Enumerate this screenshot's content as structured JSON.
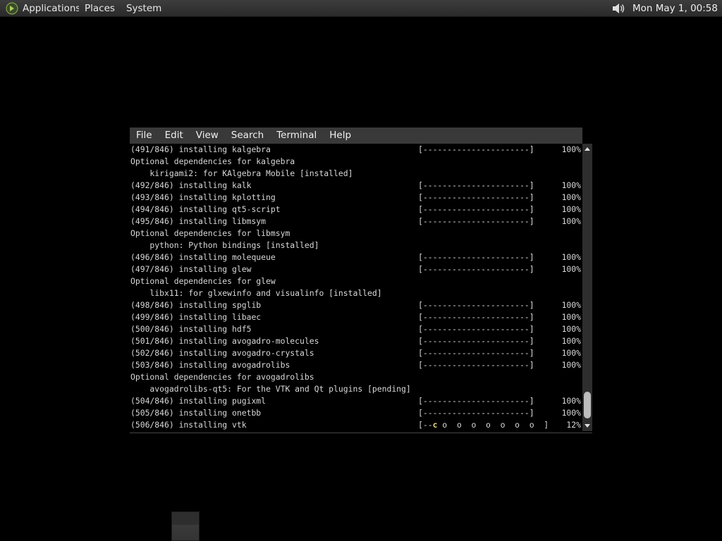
{
  "panel": {
    "menus": [
      "Applications",
      "Places",
      "System"
    ],
    "clock": "Mon May  1, 00:58",
    "logo_icon": "distro-logo-icon",
    "volume_icon": "speaker-volume-icon"
  },
  "terminal": {
    "menu": [
      "File",
      "Edit",
      "View",
      "Search",
      "Terminal",
      "Help"
    ],
    "lines": [
      {
        "text": "(491/846) installing kalgebra",
        "bar": "[----------------------]",
        "pct": "100%"
      },
      {
        "text": "Optional dependencies for kalgebra"
      },
      {
        "text": "    kirigami2: for KAlgebra Mobile [installed]"
      },
      {
        "text": "(492/846) installing kalk",
        "bar": "[----------------------]",
        "pct": "100%"
      },
      {
        "text": "(493/846) installing kplotting",
        "bar": "[----------------------]",
        "pct": "100%"
      },
      {
        "text": "(494/846) installing qt5-script",
        "bar": "[----------------------]",
        "pct": "100%"
      },
      {
        "text": "(495/846) installing libmsym",
        "bar": "[----------------------]",
        "pct": "100%"
      },
      {
        "text": "Optional dependencies for libmsym"
      },
      {
        "text": "    python: Python bindings [installed]"
      },
      {
        "text": "(496/846) installing molequeue",
        "bar": "[----------------------]",
        "pct": "100%"
      },
      {
        "text": "(497/846) installing glew",
        "bar": "[----------------------]",
        "pct": "100%"
      },
      {
        "text": "Optional dependencies for glew"
      },
      {
        "text": "    libx11: for glxewinfo and visualinfo [installed]"
      },
      {
        "text": "(498/846) installing spglib",
        "bar": "[----------------------]",
        "pct": "100%"
      },
      {
        "text": "(499/846) installing libaec",
        "bar": "[----------------------]",
        "pct": "100%"
      },
      {
        "text": "(500/846) installing hdf5",
        "bar": "[----------------------]",
        "pct": "100%"
      },
      {
        "text": "(501/846) installing avogadro-molecules",
        "bar": "[----------------------]",
        "pct": "100%"
      },
      {
        "text": "(502/846) installing avogadro-crystals",
        "bar": "[----------------------]",
        "pct": "100%"
      },
      {
        "text": "(503/846) installing avogadrolibs",
        "bar": "[----------------------]",
        "pct": "100%"
      },
      {
        "text": "Optional dependencies for avogadrolibs"
      },
      {
        "text": "    avogadrolibs-qt5: For the VTK and Qt plugins [pending]"
      },
      {
        "text": "(504/846) installing pugixml",
        "bar": "[----------------------]",
        "pct": "100%"
      },
      {
        "text": "(505/846) installing onetbb",
        "bar": "[----------------------]",
        "pct": "100%"
      },
      {
        "text": "(506/846) installing vtk",
        "bar_pre": "[--",
        "bar_hl": "c",
        "bar_post": " o  o  o  o  o  o  o  ]",
        "pct": "12%"
      }
    ],
    "current_progress": 0.12
  }
}
